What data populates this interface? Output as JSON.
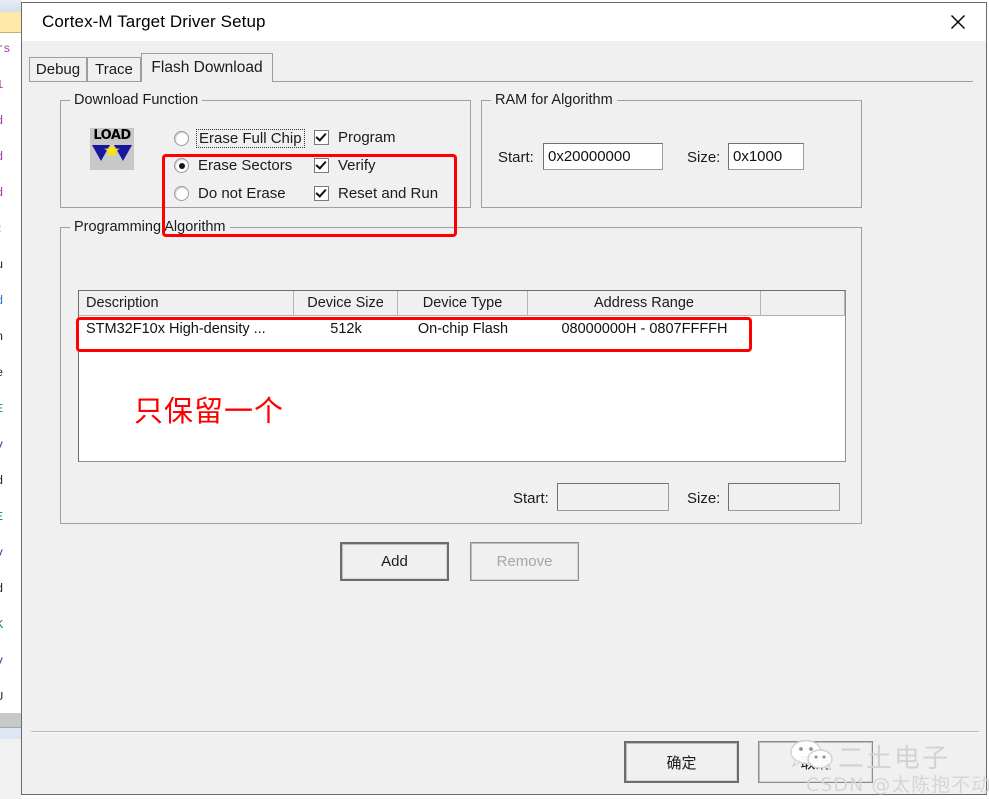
{
  "window": {
    "title": "Cortex-M Target Driver Setup",
    "close_icon": "close-icon"
  },
  "tabs": [
    {
      "label": "Debug",
      "active": false
    },
    {
      "label": "Trace",
      "active": false
    },
    {
      "label": "Flash Download",
      "active": true
    }
  ],
  "download_function": {
    "title": "Download Function",
    "icon": "load-icon",
    "icon_label": "LOAD",
    "erase_options": [
      {
        "label": "Erase Full Chip",
        "checked": false,
        "focused": true
      },
      {
        "label": "Erase Sectors",
        "checked": true,
        "focused": false
      },
      {
        "label": "Do not Erase",
        "checked": false,
        "focused": false
      }
    ],
    "checkboxes": [
      {
        "label": "Program",
        "checked": true
      },
      {
        "label": "Verify",
        "checked": true
      },
      {
        "label": "Reset and Run",
        "checked": true
      }
    ]
  },
  "ram_for_algorithm": {
    "title": "RAM for Algorithm",
    "start_label": "Start:",
    "start_value": "0x20000000",
    "size_label": "Size:",
    "size_value": "0x1000"
  },
  "programming_algorithm": {
    "title": "Programming Algorithm",
    "columns": [
      "Description",
      "Device Size",
      "Device Type",
      "Address Range",
      ""
    ],
    "rows": [
      {
        "description": "STM32F10x High-density ...",
        "device_size": "512k",
        "device_type": "On-chip Flash",
        "address_range": "08000000H - 0807FFFFH",
        "extra": ""
      }
    ],
    "start_label": "Start:",
    "start_value": "",
    "size_label": "Size:",
    "size_value": "",
    "add_label": "Add",
    "remove_label": "Remove",
    "remove_disabled": true
  },
  "annotation": {
    "note": "只保留一个",
    "color": "#fe0000"
  },
  "footer": {
    "ok_label": "确定",
    "cancel_label": "取消"
  },
  "watermark": {
    "brand": "二土电子",
    "credit": "CSDN @太陈抱不动",
    "logo_icon": "wechat-icon"
  },
  "background_editor": {
    "fragments": [
      "rs",
      "1",
      "d",
      "d",
      "d",
      ":",
      "u",
      "d",
      "n",
      "e",
      "E",
      "v",
      "d",
      "E",
      "v",
      "d",
      "K",
      "v",
      "U"
    ]
  }
}
